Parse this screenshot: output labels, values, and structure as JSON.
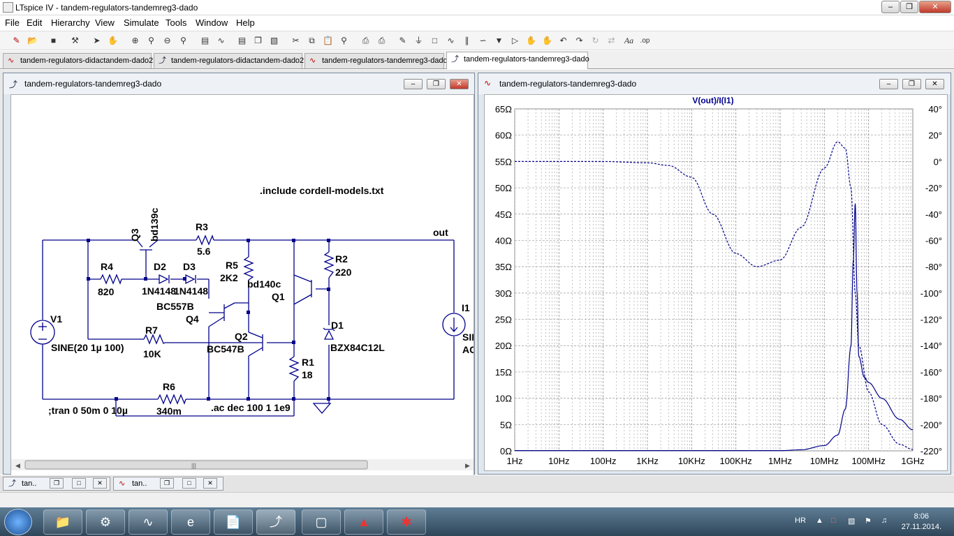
{
  "app": {
    "title": "LTspice IV - tandem-regulators-tandemreg3-dado"
  },
  "menu": [
    "File",
    "Edit",
    "Hierarchy",
    "View",
    "Simulate",
    "Tools",
    "Window",
    "Help"
  ],
  "tabs": [
    {
      "label": "tandem-regulators-didactandem-dado2",
      "kind": "plot"
    },
    {
      "label": "tandem-regulators-didactandem-dado2",
      "kind": "schematic"
    },
    {
      "label": "tandem-regulators-tandemreg3-dado",
      "kind": "plot"
    },
    {
      "label": "tandem-regulators-tandemreg3-dado",
      "kind": "schematic",
      "active": true
    }
  ],
  "schematic_window": {
    "title": "tandem-regulators-tandemreg3-dado",
    "directive_include": ".include cordell-models.txt",
    "directive_tran": ";tran 0 50m 0 10µ",
    "directive_ac": ".ac dec 100 1 1e9",
    "labels": {
      "q3_name": "Q3",
      "q3_model": "bd139c",
      "r3_name": "R3",
      "r3_value": "5.6",
      "out": "out",
      "r4_name": "R4",
      "r4_value": "820",
      "d2_name": "D2",
      "d3_name": "D3",
      "d2_model": "1N4148",
      "d3_model": "1N4148",
      "r5_name": "R5",
      "r5_value": "2K2",
      "q1_model": "bd140c",
      "q1_name": "Q1",
      "r2_name": "R2",
      "r2_value": "220",
      "q4_model": "BC557B",
      "q4_name": "Q4",
      "v1_name": "V1",
      "v1_value": "SINE(20 1µ 100)",
      "r7_name": "R7",
      "r7_value": "10K",
      "q2_name": "Q2",
      "q2_model": "BC547B",
      "d1_name": "D1",
      "d1_model": "BZX84C12L",
      "r1_name": "R1",
      "r1_value": "18",
      "i1_name": "I1",
      "i1_val1": "SII",
      "i1_val2": "AC",
      "r6_name": "R6",
      "r6_value": "340m"
    },
    "hscroll_grip": "|||"
  },
  "plot_window": {
    "title": "tandem-regulators-tandemreg3-dado",
    "trace_label": "V(out)/I(I1)"
  },
  "chart_data": {
    "type": "line",
    "title": "V(out)/I(I1)",
    "x_scale": "log",
    "x_ticks": [
      "1Hz",
      "10Hz",
      "100Hz",
      "1KHz",
      "10KHz",
      "100KHz",
      "1MHz",
      "10MHz",
      "100MHz",
      "1GHz"
    ],
    "xlim": [
      1,
      1000000000
    ],
    "y_left_ticks": [
      "65Ω",
      "60Ω",
      "55Ω",
      "50Ω",
      "45Ω",
      "40Ω",
      "35Ω",
      "30Ω",
      "25Ω",
      "20Ω",
      "15Ω",
      "10Ω",
      "5Ω",
      "0Ω"
    ],
    "ylim_left": [
      0,
      65
    ],
    "y_right_ticks": [
      "40°",
      "20°",
      "0°",
      "-20°",
      "-40°",
      "-60°",
      "-80°",
      "-100°",
      "-120°",
      "-140°",
      "-160°",
      "-180°",
      "-200°",
      "-220°"
    ],
    "ylim_right": [
      -220,
      40
    ],
    "grid": true,
    "series": [
      {
        "kind": "magnitude",
        "color": "#00008b",
        "dashed": false,
        "unit": "ohm",
        "x": [
          1,
          1000000,
          3000000,
          10000000,
          20000000,
          30000000,
          40000000,
          45000000,
          50000000,
          55000000,
          60000000,
          80000000,
          100000000,
          200000000,
          500000000,
          1000000000
        ],
        "y": [
          0.05,
          0.05,
          0.2,
          1.0,
          3.0,
          8.0,
          20.0,
          36.0,
          47.0,
          30.0,
          18.0,
          14.0,
          13.0,
          10.0,
          6.0,
          4.0
        ]
      },
      {
        "kind": "phase",
        "color": "#00008b",
        "dashed": true,
        "unit": "deg",
        "x": [
          1,
          100,
          1000,
          3000,
          10000,
          30000,
          100000,
          300000,
          1000000,
          3000000,
          10000000,
          20000000,
          30000000,
          40000000,
          50000000,
          60000000,
          100000000,
          200000000,
          500000000,
          1000000000
        ],
        "y": [
          0,
          0,
          -1,
          -3,
          -12,
          -40,
          -70,
          -80,
          -75,
          -50,
          -5,
          15,
          10,
          -20,
          -100,
          -140,
          -175,
          -200,
          -215,
          -219
        ]
      }
    ]
  },
  "minimized": [
    {
      "label": "tan..",
      "kind": "schematic"
    },
    {
      "label": "tan..",
      "kind": "plot"
    }
  ],
  "taskbar": {
    "lang": "HR",
    "time": "8:06",
    "date": "27.11.2014."
  },
  "colors": {
    "wire": "#00008b",
    "trace": "#00008b",
    "close": "#c0392b"
  }
}
